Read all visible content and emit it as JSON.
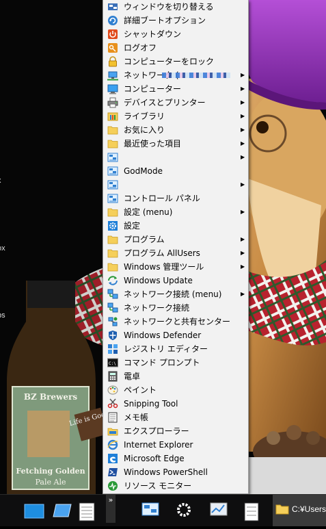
{
  "desktop": {
    "side_labels": [
      "x",
      "ox",
      "bs"
    ]
  },
  "bottle": {
    "brand": "BZ Brewers",
    "name": "Fetching Golden",
    "style": "Pale Ale",
    "tag": "Life is Good"
  },
  "menu": {
    "items": [
      {
        "label": "ウィンドウを切り替える",
        "icon": "switch-windows-icon",
        "submenu": false
      },
      {
        "label": "詳細ブートオプション",
        "icon": "refresh-icon",
        "submenu": false
      },
      {
        "label": "シャットダウン",
        "icon": "power-icon",
        "submenu": false
      },
      {
        "label": "ログオフ",
        "icon": "logoff-icon",
        "submenu": false
      },
      {
        "label": "コンピューターをロック",
        "icon": "lock-icon",
        "submenu": false
      },
      {
        "label": "ネットワーク (",
        "icon": "network-icon",
        "submenu": true
      },
      {
        "label": "コンピューター",
        "icon": "computer-icon",
        "submenu": true
      },
      {
        "label": "デバイスとプリンター",
        "icon": "printer-icon",
        "submenu": true
      },
      {
        "label": "ライブラリ",
        "icon": "library-icon",
        "submenu": true
      },
      {
        "label": "お気に入り",
        "icon": "folder-icon",
        "submenu": true
      },
      {
        "label": "最近使った項目",
        "icon": "folder-icon",
        "submenu": true
      },
      {
        "label": "",
        "icon": "control-panel-icon",
        "submenu": true
      },
      {
        "label": "GodMode",
        "icon": "control-panel-icon",
        "submenu": false
      },
      {
        "label": "",
        "icon": "control-panel-icon",
        "submenu": true
      },
      {
        "label": "コントロール パネル",
        "icon": "control-panel-icon",
        "submenu": false
      },
      {
        "label": "設定 (menu)",
        "icon": "folder-icon",
        "submenu": true
      },
      {
        "label": "設定",
        "icon": "gear-icon",
        "submenu": false
      },
      {
        "label": "プログラム",
        "icon": "folder-icon",
        "submenu": true
      },
      {
        "label": "プログラム AllUsers",
        "icon": "folder-icon",
        "submenu": true
      },
      {
        "label": "Windows 管理ツール",
        "icon": "folder-icon",
        "submenu": true
      },
      {
        "label": "Windows Update",
        "icon": "windows-update-icon",
        "submenu": false
      },
      {
        "label": "ネットワーク接続 (menu)",
        "icon": "network-connections-icon",
        "submenu": true
      },
      {
        "label": "ネットワーク接続",
        "icon": "network-connections-icon",
        "submenu": false
      },
      {
        "label": "ネットワークと共有センター",
        "icon": "sharing-center-icon",
        "submenu": false
      },
      {
        "label": "Windows Defender",
        "icon": "defender-shield-icon",
        "submenu": false
      },
      {
        "label": "レジストリ エディター",
        "icon": "registry-icon",
        "submenu": false
      },
      {
        "label": "コマンド プロンプト",
        "icon": "cmd-icon",
        "submenu": false
      },
      {
        "label": "電卓",
        "icon": "calculator-icon",
        "submenu": false
      },
      {
        "label": "ペイント",
        "icon": "paint-icon",
        "submenu": false
      },
      {
        "label": "Snipping Tool",
        "icon": "scissors-icon",
        "submenu": false
      },
      {
        "label": "メモ帳",
        "icon": "notepad-icon",
        "submenu": false
      },
      {
        "label": "エクスプローラー",
        "icon": "explorer-icon",
        "submenu": false
      },
      {
        "label": "Internet Explorer",
        "icon": "ie-icon",
        "submenu": false
      },
      {
        "label": "Microsoft Edge",
        "icon": "edge-icon",
        "submenu": false
      },
      {
        "label": "Windows PowerShell",
        "icon": "powershell-icon",
        "submenu": false
      },
      {
        "label": "リソース モニター",
        "icon": "resource-monitor-icon",
        "submenu": false
      }
    ]
  },
  "taskbar": {
    "overflow_label": "»",
    "active_window_label": "C:¥Users¥"
  },
  "colors": {
    "menu_bg": "#f2f2f2",
    "taskbar_bg": "#0e0e0f",
    "accent_blue": "#1e7fd8",
    "folder_yellow": "#f5cf5a"
  }
}
